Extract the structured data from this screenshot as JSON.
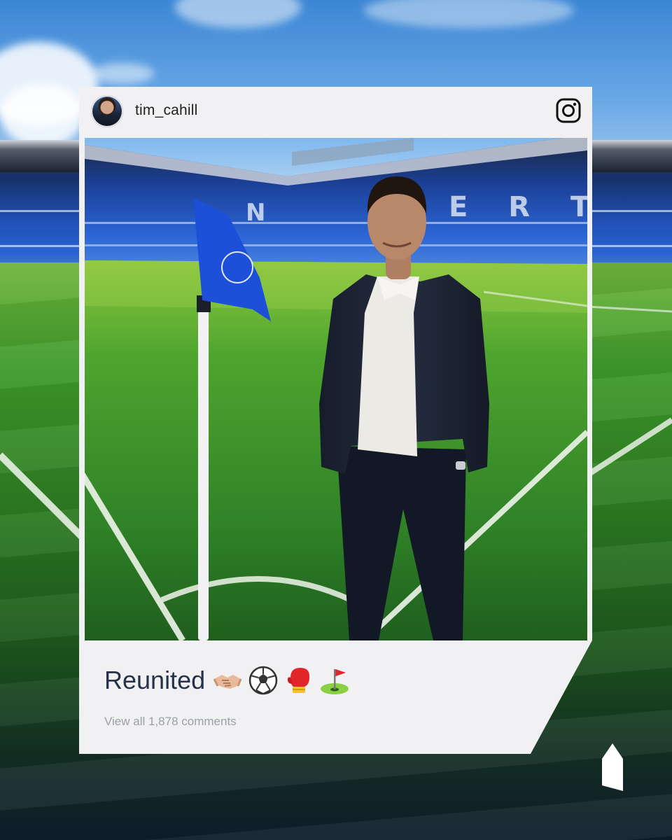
{
  "post": {
    "username": "tim_cahill",
    "caption": "Reunited",
    "caption_emojis": [
      "handshake",
      "soccer-ball",
      "boxing-glove",
      "golf-flag"
    ],
    "comments_text": "View all 1,878 comments"
  },
  "icons": {
    "platform": "instagram-icon",
    "brand": "brand-logo-icon"
  },
  "colors": {
    "card_background": "#f1f1f3",
    "flag_blue": "#1d4fd8",
    "caption_text": "#27324a",
    "comments_text": "#9aa0aa"
  }
}
